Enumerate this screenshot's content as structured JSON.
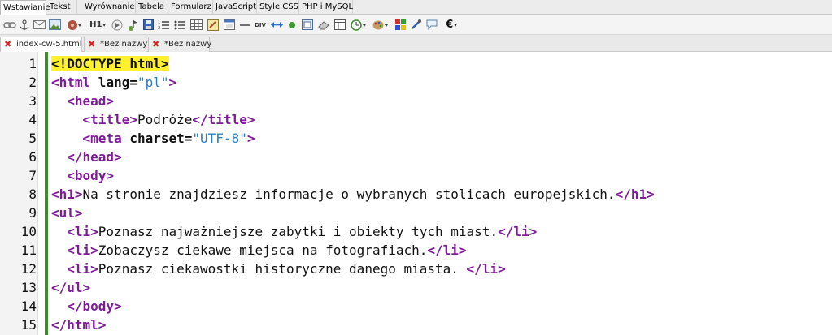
{
  "menu_tabs": [
    {
      "label": "Wstawianie",
      "active": true
    },
    {
      "label": "Tekst"
    },
    {
      "label": "Wyrównanie"
    },
    {
      "label": "Tabela"
    },
    {
      "label": "Formularz"
    },
    {
      "label": "JavaScript"
    },
    {
      "label": "Style CSS"
    },
    {
      "label": "PHP i MySQL"
    }
  ],
  "toolbar": {
    "heading_label": "H1",
    "div_label": "DIV",
    "euro_label": "€"
  },
  "doc_tabs": [
    {
      "label": "index-cw-5.html",
      "active": true
    },
    {
      "label": "*Bez nazwy"
    },
    {
      "label": "*Bez nazwy"
    }
  ],
  "editor": {
    "line_numbers": [
      "1",
      "2",
      "3",
      "4",
      "5",
      "6",
      "7",
      "8",
      "9",
      "10",
      "11",
      "12",
      "13",
      "14",
      "15"
    ],
    "lines": {
      "l1": {
        "doctype": "<!DOCTYPE html>"
      },
      "l2": {
        "open": "<html",
        "attr": " lang=",
        "val": "\"pl\"",
        "close": ">"
      },
      "l3": {
        "indent": "  ",
        "tag": "<head>"
      },
      "l4": {
        "indent": "    ",
        "open": "<title>",
        "text": "Podróże",
        "close": "</title>"
      },
      "l5": {
        "indent": "    ",
        "open": "<meta",
        "attr": " charset=",
        "val": "\"UTF-8\"",
        "close": ">"
      },
      "l6": {
        "indent": "  ",
        "tag": "</head>"
      },
      "l7": {
        "indent": "  ",
        "tag": "<body>"
      },
      "l8": {
        "open": "<h1>",
        "text": "Na stronie znajdziesz informacje o wybranych stolicach europejskich.",
        "close": "</h1>"
      },
      "l9": {
        "tag": "<ul>"
      },
      "l10": {
        "indent": "  ",
        "open": "<li>",
        "text": "Poznasz najważniejsze zabytki i obiekty tych miast.",
        "close": "</li>"
      },
      "l11": {
        "indent": "  ",
        "open": "<li>",
        "text": "Zobaczysz ciekawe miejsca na fotografiach.",
        "close": "</li>"
      },
      "l12": {
        "indent": "  ",
        "open": "<li>",
        "text": "Poznasz ciekawostki historyczne danego miasta. ",
        "close": "</li>"
      },
      "l13": {
        "tag": "</ul>"
      },
      "l14": {
        "indent": "  ",
        "tag": "</body>"
      },
      "l15": {
        "tag": "</html>"
      }
    }
  }
}
